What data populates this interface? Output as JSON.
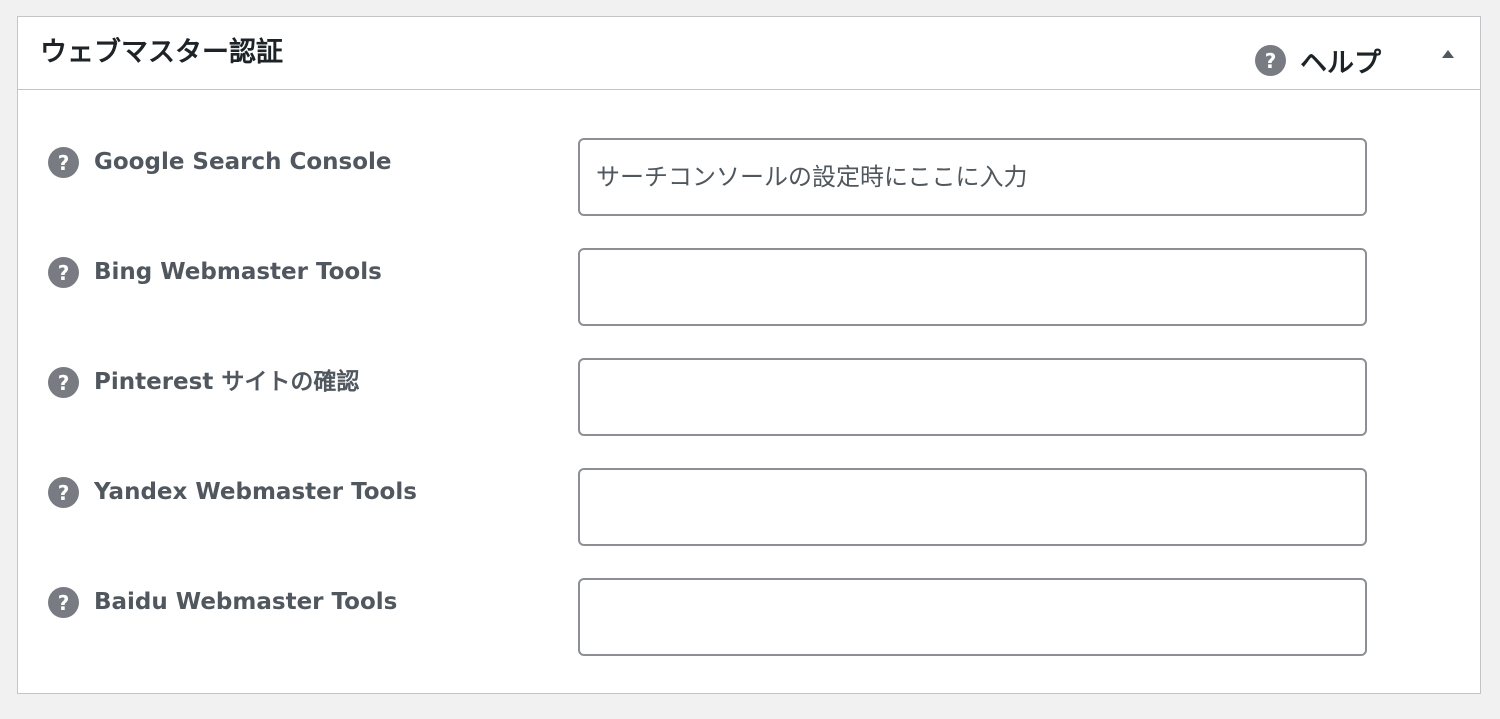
{
  "panel": {
    "title": "ウェブマスター認証",
    "help_label": "ヘルプ",
    "help_icon": "question-circle-icon",
    "toggle_icon": "triangle-up-icon"
  },
  "fields": [
    {
      "label": "Google Search Console",
      "placeholder": "サーチコンソールの設定時にここに入力",
      "value": ""
    },
    {
      "label": "Bing Webmaster Tools",
      "placeholder": "",
      "value": ""
    },
    {
      "label": "Pinterest サイトの確認",
      "placeholder": "",
      "value": ""
    },
    {
      "label": "Yandex Webmaster Tools",
      "placeholder": "",
      "value": ""
    },
    {
      "label": "Baidu Webmaster Tools",
      "placeholder": "",
      "value": ""
    }
  ],
  "colors": {
    "page_bg": "#f1f1f1",
    "panel_bg": "#ffffff",
    "border": "#c3c4c7",
    "icon_bg": "#787c82",
    "label_text": "#50575e",
    "title_text": "#1d2327"
  }
}
